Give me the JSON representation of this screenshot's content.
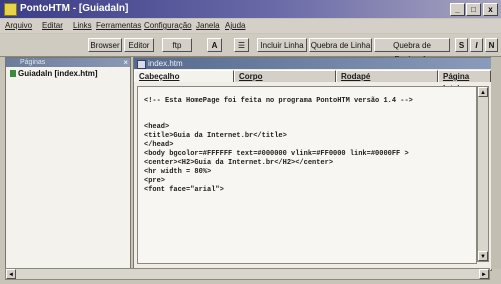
{
  "window": {
    "title": "PontoHTM - [Guiadaln]",
    "controls": [
      "_",
      "□",
      "x"
    ]
  },
  "menu": [
    "Arquivo",
    "Editar",
    "Links",
    "Ferramentas",
    "Configuração",
    "Janela",
    "Ajuda"
  ],
  "toolbar": {
    "browser": "Browser",
    "editor": "Editor",
    "ftp": "ftp",
    "font_a": "A",
    "align": "☰",
    "incluir_linha": "Incluir Linha",
    "quebra_linha": "Quebra de Linha",
    "quebra_paragrafo": "Quebra de Parágrafo",
    "fmt1": "S",
    "fmt2": "I",
    "fmt3": "N"
  },
  "left_panel": {
    "header": "Páginas",
    "close": "×",
    "tree_item": "Guiadaln [index.htm]"
  },
  "editor": {
    "header": "index.htm",
    "tabs": [
      "Cabeçalho",
      "Corpo",
      "Rodapé",
      "Página Inteira"
    ],
    "code_lines": [
      "<!-- Esta HomePage foi feita no programa PontoHTM versão 1.4 -->",
      "",
      "<head>",
      "<title>Guia da Internet.br</title>",
      "</head>",
      "<body bgcolor=#FFFFFF text=#000000 vlink=#FF0000 link=#0000FF >",
      "<center><H2>Guia da Internet.br</H2></center>",
      "<hr width = 80%>",
      "<pre>",
      "<font face=\"arial\">"
    ]
  },
  "scroll": {
    "left": "◄",
    "right": "►",
    "up": "▲",
    "down": "▼"
  }
}
